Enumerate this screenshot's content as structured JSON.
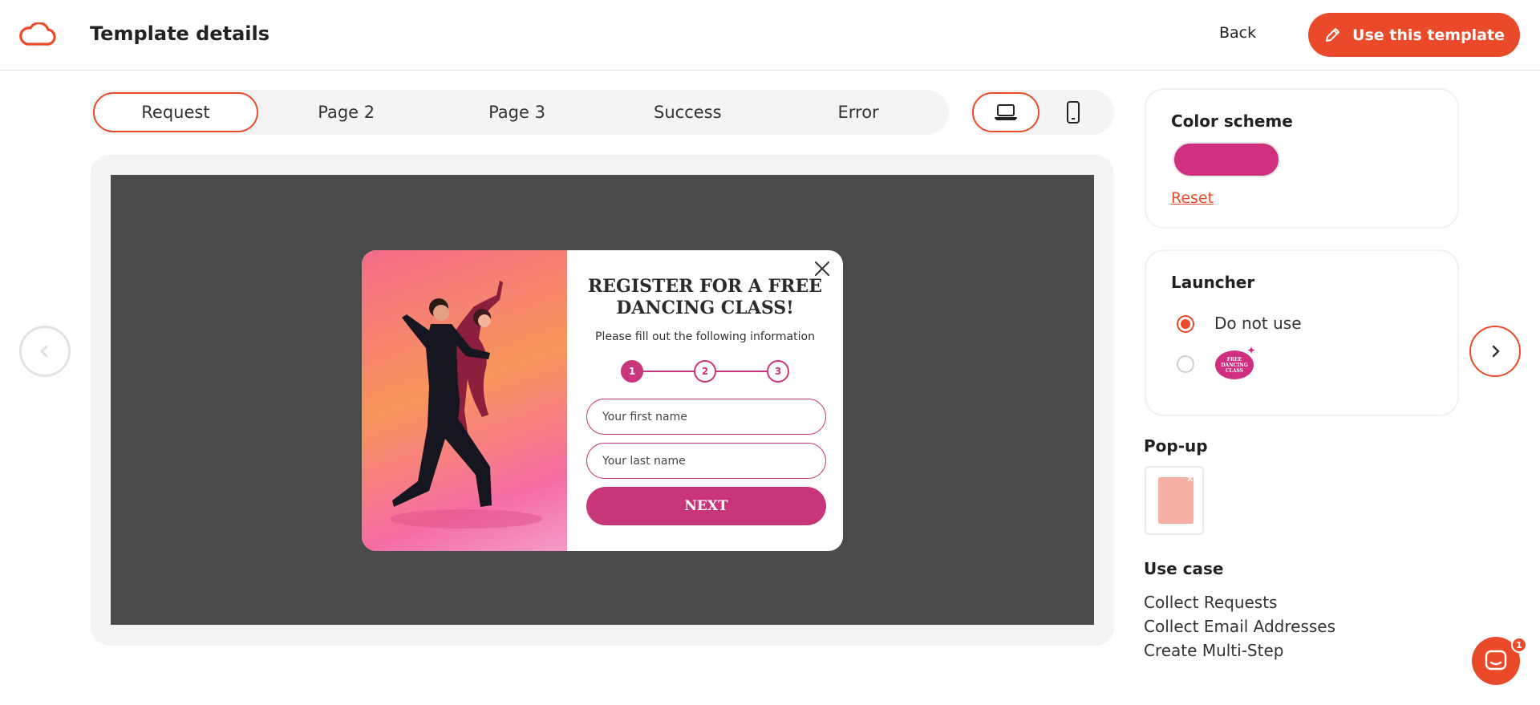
{
  "header": {
    "title": "Template details",
    "back_label": "Back",
    "use_template_label": "Use this template"
  },
  "tabs": [
    {
      "label": "Request",
      "active": true
    },
    {
      "label": "Page 2",
      "active": false
    },
    {
      "label": "Page 3",
      "active": false
    },
    {
      "label": "Success",
      "active": false
    },
    {
      "label": "Error",
      "active": false
    }
  ],
  "devices": {
    "desktop_icon": "laptop-icon",
    "mobile_icon": "phone-icon",
    "active": "desktop"
  },
  "popup": {
    "title": "REGISTER FOR A FREE DANCING CLASS!",
    "subtitle": "Please fill out the following information",
    "steps": [
      "1",
      "2",
      "3"
    ],
    "active_step": 1,
    "first_name_placeholder": "Your first name",
    "last_name_placeholder": "Your last name",
    "next_label": "NEXT"
  },
  "panel": {
    "color_scheme": {
      "title": "Color scheme",
      "color": "#cf2f7e",
      "reset_label": "Reset"
    },
    "launcher": {
      "title": "Launcher",
      "option_none_label": "Do not use",
      "badge_text": "FREE DANCING CLASS",
      "selected": "none"
    },
    "popup_section_title": "Pop-up",
    "use_case_title": "Use case",
    "use_cases": [
      "Collect Requests",
      "Collect Email Addresses",
      "Create Multi-Step"
    ]
  },
  "chat": {
    "badge_count": "1"
  },
  "colors": {
    "accent": "#ea4a2a",
    "popup_brand": "#c9357a",
    "preview_background": "#4a4a4a"
  }
}
